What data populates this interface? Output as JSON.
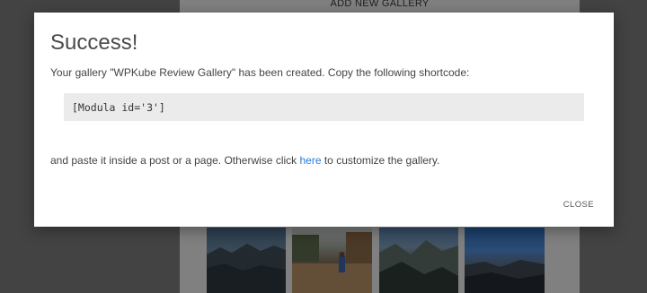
{
  "background": {
    "header_text": "ADD NEW GALLERY"
  },
  "modal": {
    "title": "Success!",
    "message": "Your gallery \"WPKube Review Gallery\" has been created. Copy the following shortcode:",
    "shortcode": "[Modula id='3']",
    "paste_before": "and paste it inside a post or a page. Otherwise click ",
    "link_text": "here",
    "paste_after": " to customize the gallery.",
    "close_label": "CLOSE"
  },
  "colors": {
    "link": "#2a7ad9",
    "overlay": "rgba(0,0,0,0.45)",
    "shortcode_bg": "#ebebeb"
  }
}
